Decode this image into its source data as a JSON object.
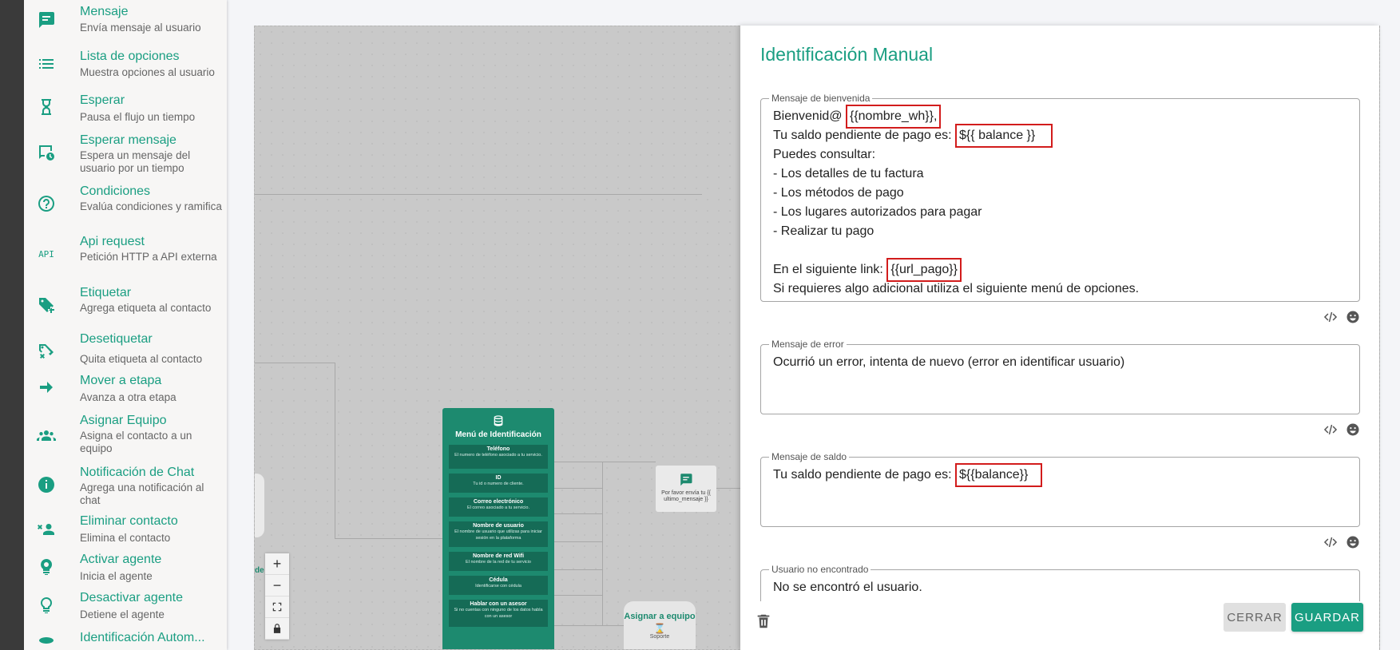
{
  "sidebar": {
    "items": [
      {
        "title": "Mensaje",
        "desc": "Envía mensaje al usuario",
        "icon": "message-icon"
      },
      {
        "title": "Lista de opciones",
        "desc": "Muestra opciones al usuario",
        "icon": "list-icon"
      },
      {
        "title": "Esperar",
        "desc": "Pausa el flujo un tiempo",
        "icon": "hourglass-icon"
      },
      {
        "title": "Esperar mensaje",
        "desc": "Espera un mensaje del usuario por un tiempo",
        "icon": "clock-message-icon"
      },
      {
        "title": "Condiciones",
        "desc": "Evalúa condiciones y ramifica",
        "icon": "help-circle-icon"
      },
      {
        "title": "Api request",
        "desc": "Petición HTTP a API externa",
        "icon": "api-icon",
        "icon_text": "API"
      },
      {
        "title": "Etiquetar",
        "desc": "Agrega etiqueta al contacto",
        "icon": "tag-add-icon"
      },
      {
        "title": "Desetiquetar",
        "desc": "Quita etiqueta al contacto",
        "icon": "tag-remove-icon"
      },
      {
        "title": "Mover a etapa",
        "desc": "Avanza a otra etapa",
        "icon": "arrow-right-icon"
      },
      {
        "title": "Asignar Equipo",
        "desc": "Asigna el contacto a un equipo",
        "icon": "team-icon"
      },
      {
        "title": "Notificación de Chat",
        "desc": "Agrega una notificación al chat",
        "icon": "info-icon"
      },
      {
        "title": "Eliminar contacto",
        "desc": "Elimina el contacto",
        "icon": "remove-user-icon"
      },
      {
        "title": "Activar agente",
        "desc": "Inicia el agente",
        "icon": "agent-on-icon"
      },
      {
        "title": "Desactivar agente",
        "desc": "Detiene el agente",
        "icon": "agent-off-icon"
      },
      {
        "title": "Identificación Autom...",
        "desc": "",
        "icon": "id-icon"
      }
    ]
  },
  "canvas": {
    "menu_node": {
      "title": "Menú de Identificación",
      "options": [
        {
          "title": "Teléfono",
          "desc": "El numero de teléfono asociado a tu servicio."
        },
        {
          "title": "ID",
          "desc": "Tu id o numero de cliente."
        },
        {
          "title": "Correo electrónico",
          "desc": "El correo asociado a tu servicio."
        },
        {
          "title": "Nombre de usuario",
          "desc": "El nombre de usuario que utilizas para iniciar sesión en la plataforma"
        },
        {
          "title": "Nombre de red Wifi",
          "desc": "El nombre de la red de tu servicio"
        },
        {
          "title": "Cédula",
          "desc": "Identificarse con cédula"
        },
        {
          "title": "Hablar con un asesor",
          "desc": "Si no cuentas con ninguno de los datos habla con un asesor"
        }
      ]
    },
    "message_node": {
      "text": "Por favor envía tu {{ ultimo_mensaje }}"
    },
    "assign_node": {
      "title": "Asignar a equipo",
      "sub": "Soporte"
    },
    "edge_label": "de",
    "zoom": {
      "plus": "+",
      "minus": "−"
    }
  },
  "panel": {
    "title": "Identificación Manual",
    "welcome": {
      "label": "Mensaje de bienvenida",
      "lines": {
        "l1_pre": "Bienvenid@ ",
        "l1_mark": "{{nombre_wh}},",
        "l2_pre": "Tu saldo pendiente de pago es: ",
        "l2_mark": "${{ balance }}",
        "l3": "Puedes consultar:",
        "l4": "- Los detalles de tu factura",
        "l5": "- Los métodos de pago",
        "l6": "- Los lugares autorizados para pagar",
        "l7": "- Realizar tu pago",
        "l9_pre": "En el siguiente link: ",
        "l9_mark": "{{url_pago}}",
        "l10": "Si requieres algo adicional utiliza el siguiente menú de opciones."
      }
    },
    "error": {
      "label": "Mensaje de error",
      "value": "Ocurrió un error, intenta de nuevo (error en identificar usuario)"
    },
    "balance": {
      "label": "Mensaje de saldo",
      "pre": "Tu saldo pendiente de pago es: ",
      "mark": "${{balance}}"
    },
    "not_found": {
      "label": "Usuario no encontrado",
      "value": "No se encontró el usuario."
    },
    "buttons": {
      "close": "CERRAR",
      "save": "GUARDAR"
    }
  },
  "colors": {
    "accent": "#1a9e82",
    "highlight_border": "#d21c1c"
  }
}
